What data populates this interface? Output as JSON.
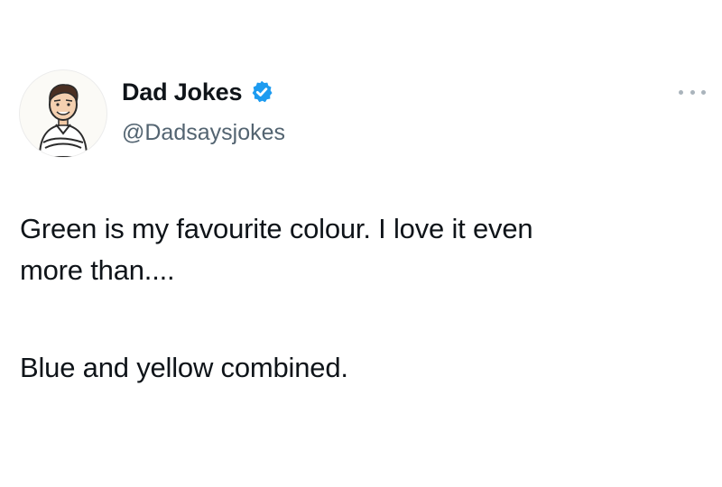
{
  "author": {
    "display_name": "Dad Jokes",
    "handle": "@Dadsaysjokes",
    "verified": true,
    "verified_color": "#1d9bf0"
  },
  "more_icon": "more-horizontal-icon",
  "tweet": {
    "lines": [
      "Green is my favourite colour. I love it even",
      "more than....",
      "Blue and yellow combined."
    ]
  }
}
